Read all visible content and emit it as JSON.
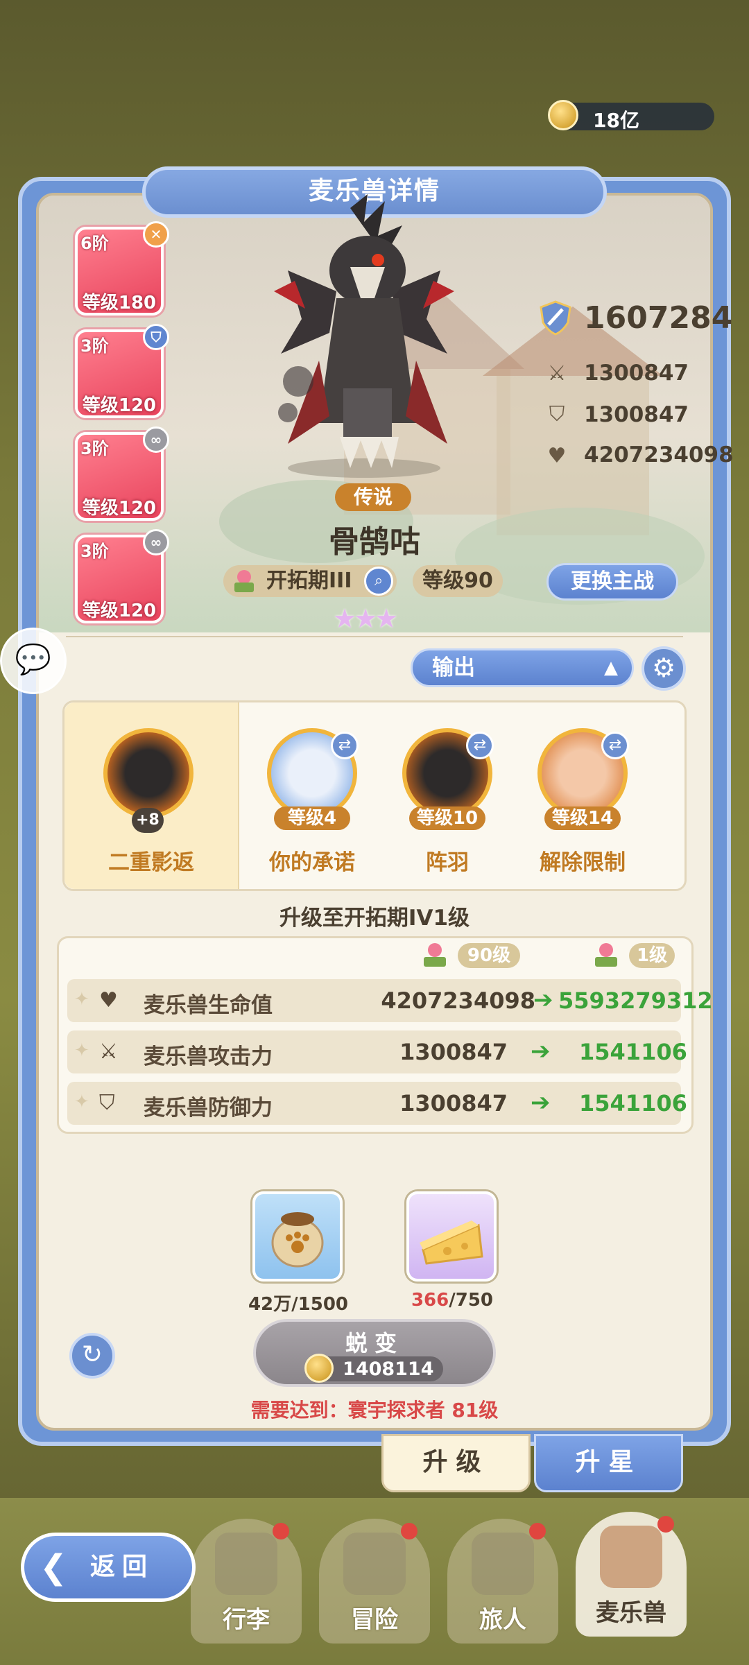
{
  "currency": {
    "amount": "18亿",
    "icon": "gold-coin-icon"
  },
  "panel": {
    "title": "麦乐兽详情"
  },
  "team": [
    {
      "rank": "6阶",
      "level": "等级180",
      "badge_icon": "swords-icon",
      "badge_color": "#f0a04a"
    },
    {
      "rank": "3阶",
      "level": "等级120",
      "badge_icon": "shield-icon",
      "badge_color": "#5f86d0"
    },
    {
      "rank": "3阶",
      "level": "等级120",
      "badge_icon": "link-icon",
      "badge_color": "#9a9aa0"
    },
    {
      "rank": "3阶",
      "level": "等级120",
      "badge_icon": "link-icon",
      "badge_color": "#9a9aa0"
    }
  ],
  "pet": {
    "rarity": "传说",
    "name": "骨鹄咕",
    "stage": "开拓期III",
    "level": "等级90",
    "stars": "★★★",
    "switch_label": "更换主战"
  },
  "stats": {
    "power": "1607284",
    "attack": "1300847",
    "defense": "1300847",
    "hp": "4207234098"
  },
  "role": {
    "selected": "输出"
  },
  "skills": [
    {
      "name": "二重影返",
      "badge": "+8",
      "selected": true
    },
    {
      "name": "你的承诺",
      "level": "等级4"
    },
    {
      "name": "阵羽",
      "level": "等级10"
    },
    {
      "name": "解除限制",
      "level": "等级14"
    }
  ],
  "upgrade": {
    "title": "升级至开拓期IV1级",
    "from_level": "90级",
    "to_level": "1级",
    "rows": [
      {
        "name": "麦乐兽生命值",
        "old": "4207234098",
        "new": "5593279312",
        "icon": "heart-icon"
      },
      {
        "name": "麦乐兽攻击力",
        "old": "1300847",
        "new": "1541106",
        "icon": "swords-icon"
      },
      {
        "name": "麦乐兽防御力",
        "old": "1300847",
        "new": "1541106",
        "icon": "shield-icon"
      }
    ]
  },
  "materials": [
    {
      "icon": "food-bag-icon",
      "have": "42万",
      "need": "/1500",
      "have_color": "#4a3f30"
    },
    {
      "icon": "cheese-icon",
      "have": "366",
      "need": "/750",
      "have_color": "#d84848"
    }
  ],
  "evolve": {
    "label": "蜕变",
    "cost": "1408114",
    "requirement": "需要达到：寰宇探求者 81级"
  },
  "tabs": {
    "upgrade": "升级",
    "star": "升星"
  },
  "nav": {
    "back": "返回",
    "items": [
      "行李",
      "冒险",
      "旅人",
      "麦乐兽"
    ]
  }
}
